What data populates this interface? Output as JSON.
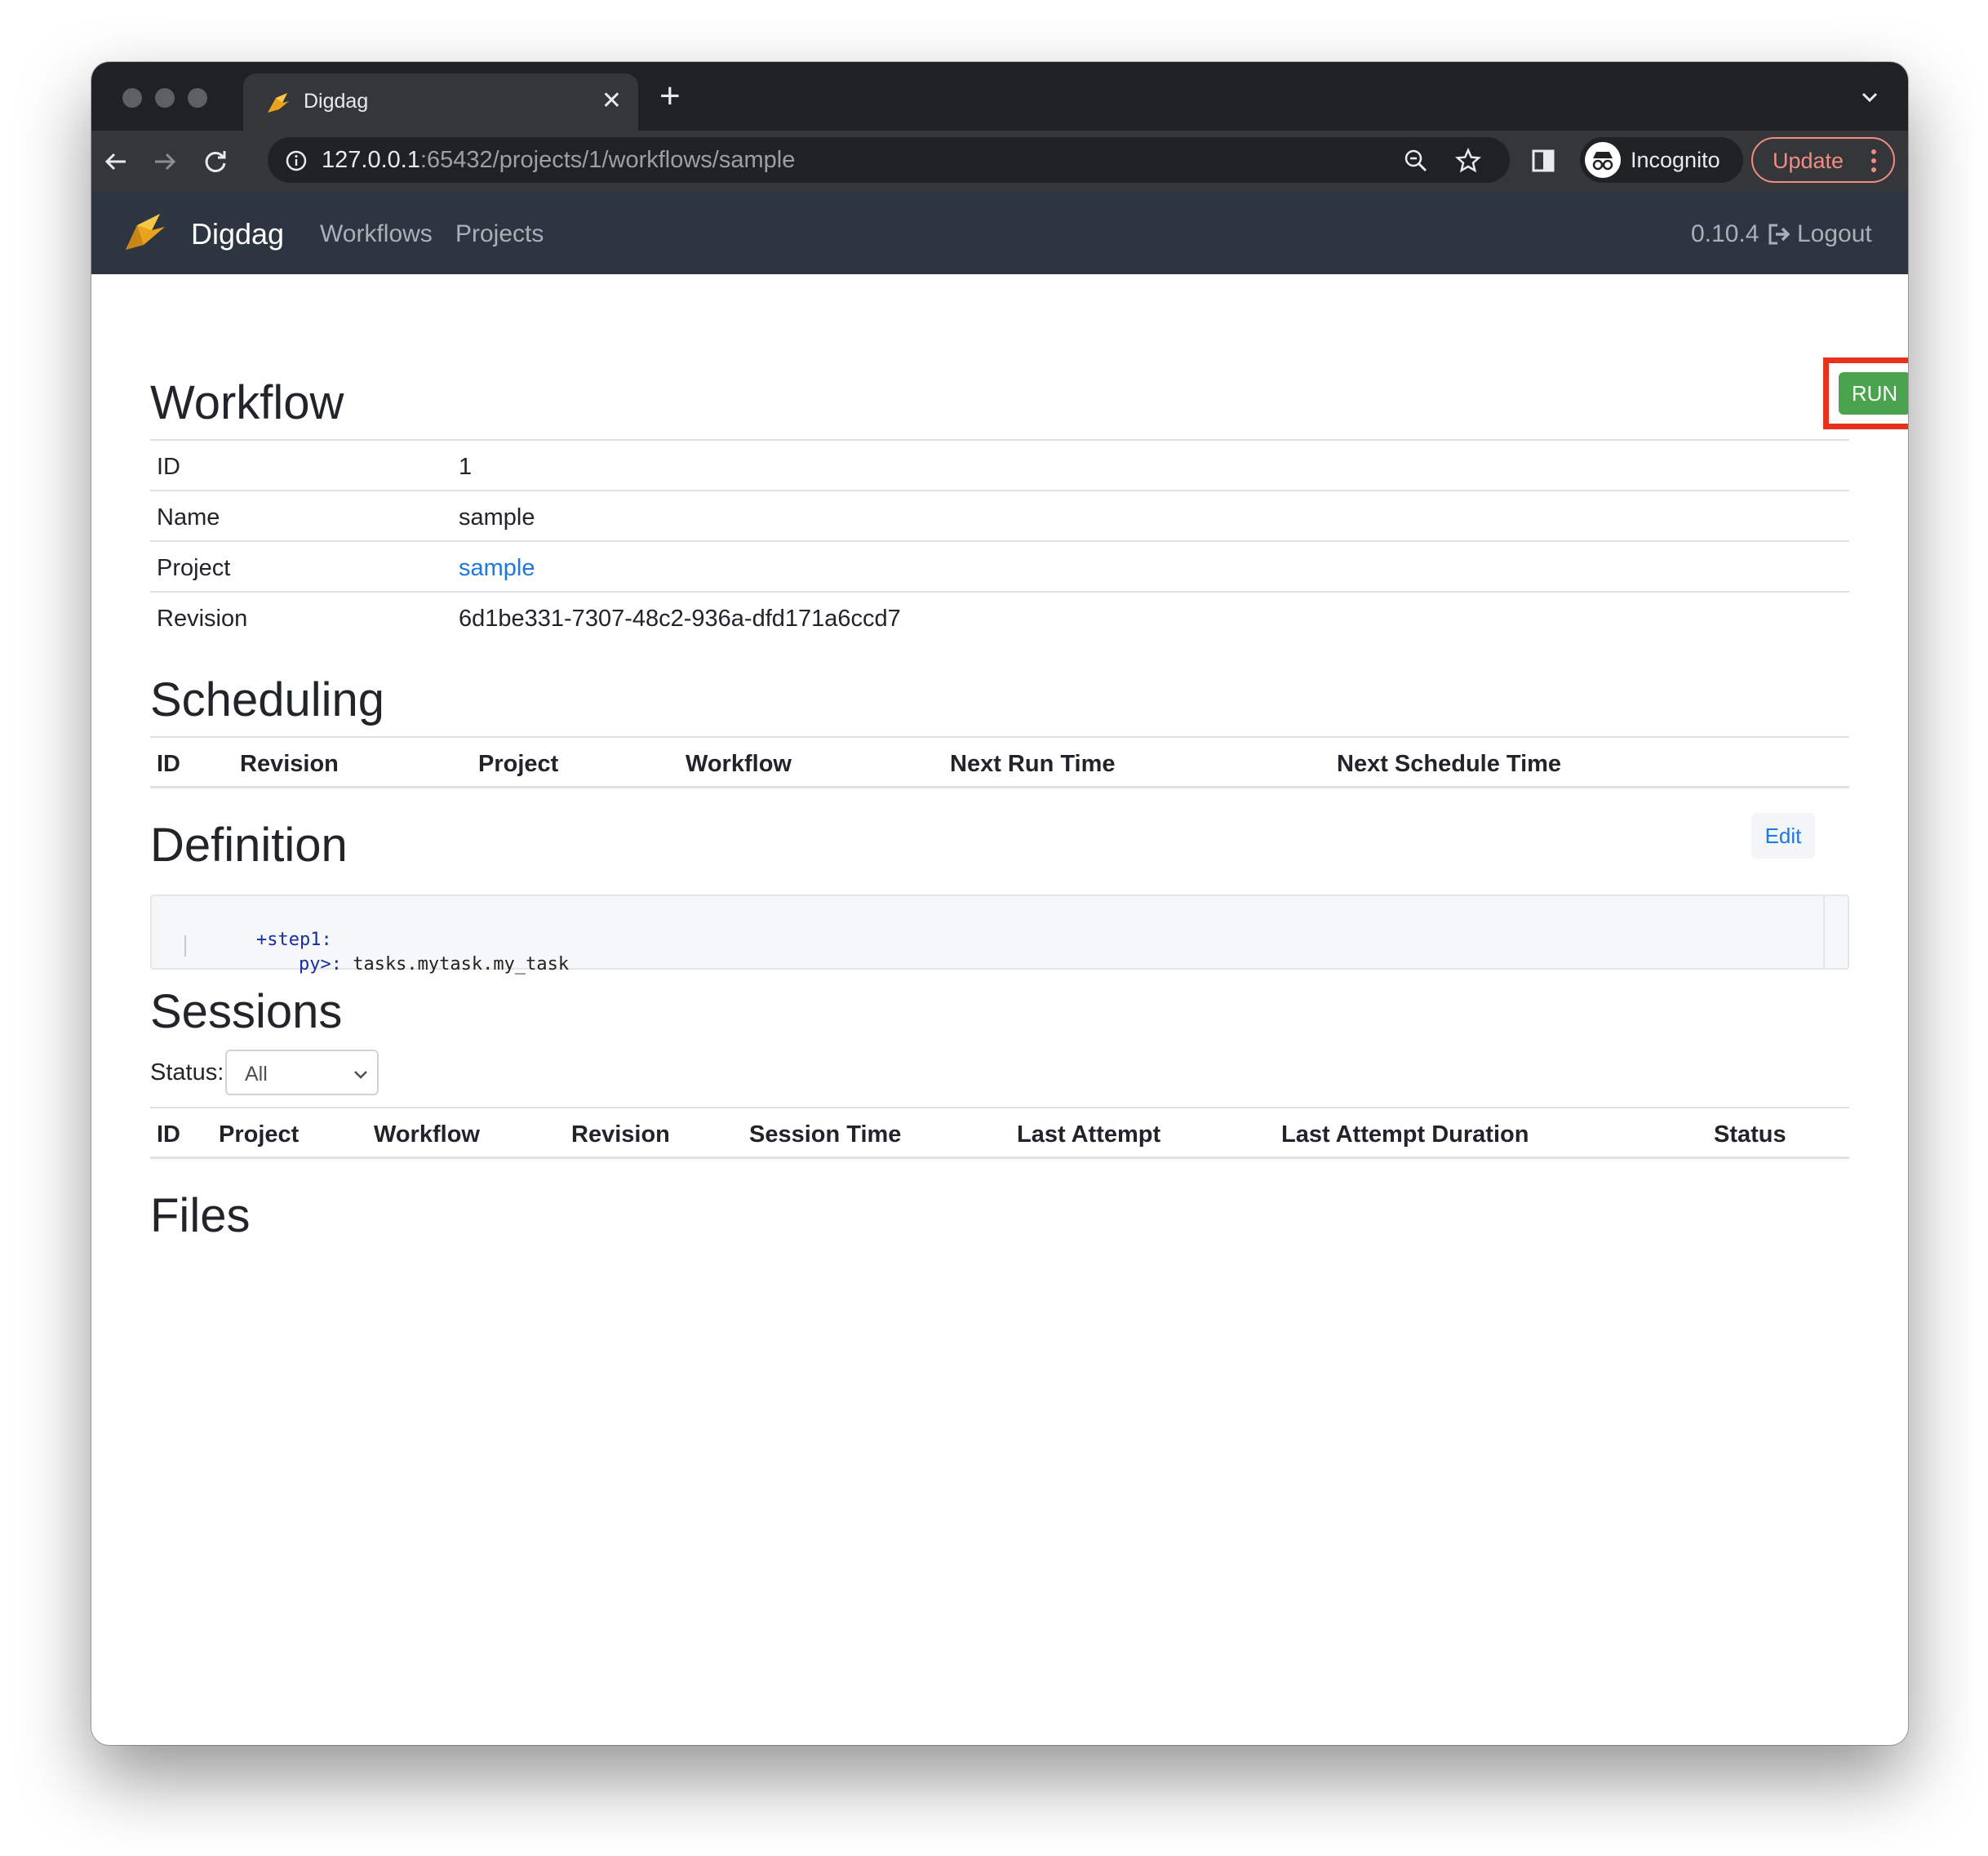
{
  "browser": {
    "tab_title": "Digdag",
    "tab_close": "✕",
    "new_tab": "+",
    "url_host": "127.0.0.1",
    "url_path": ":65432/projects/1/workflows/sample",
    "incognito_label": "Incognito",
    "update_label": "Update"
  },
  "navbar": {
    "brand": "Digdag",
    "links": [
      "Workflows",
      "Projects"
    ],
    "version": "0.10.4",
    "logout": "Logout"
  },
  "workflow": {
    "title": "Workflow",
    "run_label": "RUN",
    "rows": [
      {
        "key": "ID",
        "value": "1"
      },
      {
        "key": "Name",
        "value": "sample"
      },
      {
        "key": "Project",
        "value": "sample"
      },
      {
        "key": "Revision",
        "value": "6d1be331-7307-48c2-936a-dfd171a6ccd7"
      }
    ]
  },
  "scheduling": {
    "title": "Scheduling",
    "columns": [
      "ID",
      "Revision",
      "Project",
      "Workflow",
      "Next Run Time",
      "Next Schedule Time"
    ]
  },
  "definition": {
    "title": "Definition",
    "edit_label": "Edit",
    "line1_key": "+step1:",
    "line2_key": "py>:",
    "line2_value": "tasks.mytask.my_task"
  },
  "sessions": {
    "title": "Sessions",
    "status_label": "Status:",
    "status_selected": "All",
    "columns": [
      "ID",
      "Project",
      "Workflow",
      "Revision",
      "Session Time",
      "Last Attempt",
      "Last Attempt Duration",
      "Status"
    ]
  },
  "files": {
    "title": "Files"
  },
  "colors": {
    "navbar_bg": "#2d3540",
    "run_green": "#4aa34e",
    "highlight_red": "#e8321e",
    "link_blue": "#1d78e0"
  }
}
